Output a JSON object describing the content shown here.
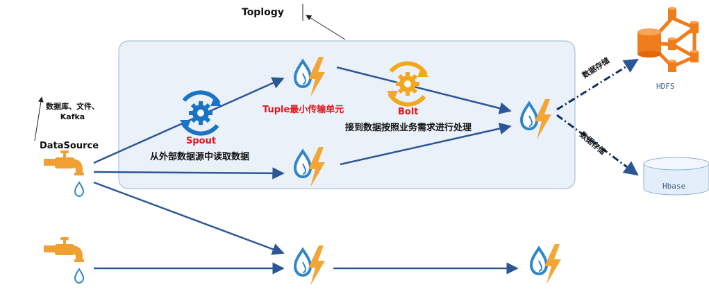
{
  "colors": {
    "arrow": "#2c5696",
    "topology_fill": "#eaf1f9",
    "topology_border": "#9ab6d6",
    "water": "#2f86c8",
    "bolt": "#f3a536",
    "spout_gear": "#1b73c4",
    "bolt_gear": "#f2a71d",
    "highlight_text": "#e5141c",
    "hdfs": "#f07d1c",
    "hbase_fill": "#e3eefa"
  },
  "topology": {
    "title": "Toplogy"
  },
  "datasource": {
    "title": "DataSource",
    "note_line1": "数据库、文件、",
    "note_line2": "Kafka"
  },
  "spout": {
    "name": "Spout",
    "description": "从外部数据源中读取数据"
  },
  "tuple": {
    "label": "Tuple最小传输单元"
  },
  "bolt": {
    "name": "Bolt",
    "description": "接到数据按照业务需求进行处理"
  },
  "storage": {
    "hdfs_label": "HDFS",
    "hbase_label": "Hbase",
    "store_text_1": "数据存储",
    "store_text_2": "数据存储"
  },
  "icons": {
    "datasource_tap": "faucet-icon",
    "stream_node": "water-lightning-icon",
    "spout": "refresh-gear-icon",
    "bolt": "refresh-gear-icon",
    "hdfs": "hdfs-cluster-icon",
    "hbase": "database-cylinder-icon"
  }
}
